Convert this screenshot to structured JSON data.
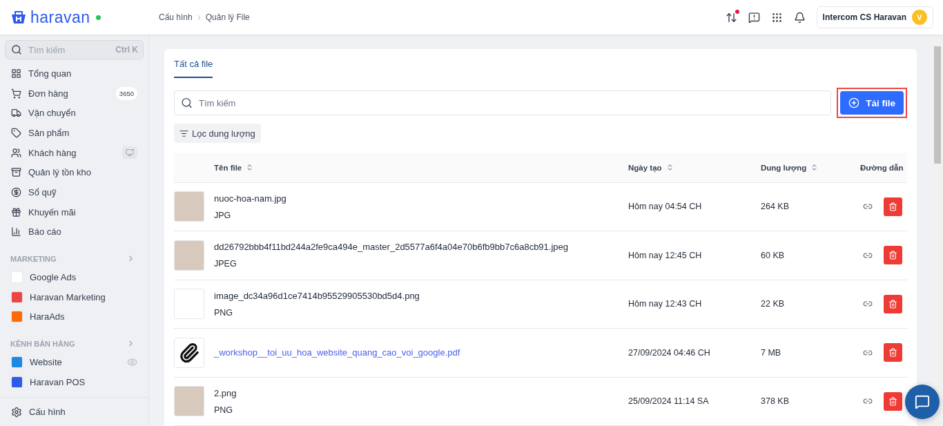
{
  "header": {
    "brand": "haravan",
    "breadcrumb": [
      "Cấu hình",
      "Quản lý File"
    ],
    "account": {
      "name": "Intercom CS Haravan",
      "initial": "V"
    }
  },
  "sidebar": {
    "search": {
      "placeholder": "Tìm kiếm",
      "shortcut": "Ctrl K"
    },
    "items": [
      {
        "label": "Tổng quan"
      },
      {
        "label": "Đơn hàng",
        "badge": "3650"
      },
      {
        "label": "Vận chuyển"
      },
      {
        "label": "Sản phẩm"
      },
      {
        "label": "Khách hàng"
      },
      {
        "label": "Quản lý tồn kho"
      },
      {
        "label": "Sổ quỹ"
      },
      {
        "label": "Khuyến mãi"
      },
      {
        "label": "Báo cáo"
      }
    ],
    "sections": [
      {
        "title": "MARKETING",
        "apps": [
          {
            "label": "Google Ads",
            "color": "#ffffff"
          },
          {
            "label": "Haravan Marketing",
            "color": "#ef4444"
          },
          {
            "label": "HaraAds",
            "color": "#ff6a00"
          }
        ]
      },
      {
        "title": "KÊNH BÁN HÀNG",
        "apps": [
          {
            "label": "Website",
            "color": "#1e88e5"
          },
          {
            "label": "Haravan POS",
            "color": "#2f5bea"
          }
        ]
      }
    ],
    "footer": "Cấu hình"
  },
  "main": {
    "tabs": [
      {
        "label": "Tất cả file",
        "selected": true
      }
    ],
    "search": {
      "placeholder": "Tìm kiếm"
    },
    "upload_button": {
      "label": "Tải file",
      "highlighted": true
    },
    "filter_button": "Lọc dung lượng",
    "table": {
      "columns": [
        "Tên file",
        "Ngày tạo",
        "Dung lượng",
        "Đường dẫn"
      ],
      "rows": [
        {
          "kind": "image",
          "name": "nuoc-hoa-nam.jpg",
          "type": "JPG",
          "created": "Hôm nay 04:54 CH",
          "size": "264 KB"
        },
        {
          "kind": "image",
          "name": "dd26792bbb4f11bd244a2fe9ca494e_master_2d5577a6f4a04e70b6fb9bb7c6a8cb91.jpeg",
          "type": "JPEG",
          "created": "Hôm nay 12:45 CH",
          "size": "60 KB"
        },
        {
          "kind": "blank",
          "name": "image_dc34a96d1ce7414b95529905530bd5d4.png",
          "type": "PNG",
          "created": "Hôm nay 12:43 CH",
          "size": "22 KB"
        },
        {
          "kind": "document",
          "name": "_workshop__toi_uu_hoa_website_quang_cao_voi_google.pdf",
          "created": "27/09/2024 04:46 CH",
          "size": "7 MB"
        },
        {
          "kind": "image",
          "name": "2.png",
          "type": "PNG",
          "created": "25/09/2024 11:14 SA",
          "size": "378 KB"
        }
      ]
    }
  }
}
